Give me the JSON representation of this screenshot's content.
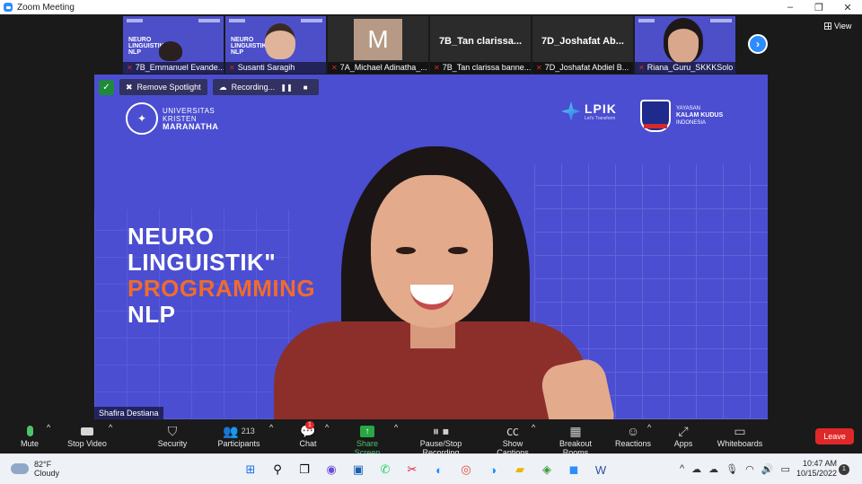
{
  "window": {
    "title": "Zoom Meeting",
    "minimize": "–",
    "maximize": "❐",
    "close": "✕"
  },
  "view_button": "View",
  "thumbnails": [
    {
      "name": "7B_Emmanuel Evande...",
      "type": "slide",
      "muted": true
    },
    {
      "name": "Susanti Saragih",
      "type": "slide",
      "muted": true
    },
    {
      "name": "7A_Michael Adinatha_...",
      "type": "avatar",
      "avatar_letter": "M",
      "muted": true
    },
    {
      "name": "7B_Tan clarissa banne...",
      "type": "name",
      "display": "7B_Tan clarissa...",
      "muted": true
    },
    {
      "name": "7D_Joshafat Abdiel B...",
      "type": "name",
      "display": "7D_Joshafat Ab...",
      "muted": true
    },
    {
      "name": "Riana_Guru_SKKKSolo",
      "type": "video",
      "muted": true
    }
  ],
  "slide_mini_title": [
    "NEURO",
    "LINGUISTIK\"",
    "PROGRAMMING",
    "NLP"
  ],
  "video_toolbar": {
    "remove_spotlight": "Remove Spotlight",
    "recording": "Recording..."
  },
  "slide": {
    "university": [
      "UNIVERSITAS",
      "KRISTEN",
      "MARANATHA"
    ],
    "lpik": "LPIK",
    "lpik_sub": "Let's Transform",
    "yayasan": [
      "YAYASAN",
      "KALAM KUDUS",
      "INDONESIA"
    ],
    "title_lines": [
      "NEURO",
      "LINGUISTIK\"",
      "PROGRAMMING",
      "NLP"
    ]
  },
  "speaker_name": "Shafira Destiana",
  "toolbar": {
    "mute": "Mute",
    "stop_video": "Stop Video",
    "security": "Security",
    "participants": "Participants",
    "participants_count": "213",
    "chat": "Chat",
    "chat_badge": "1",
    "share_screen": "Share Screen",
    "pause_stop_recording": "Pause/Stop Recording",
    "show_captions": "Show Captions",
    "breakout_rooms": "Breakout Rooms",
    "reactions": "Reactions",
    "apps": "Apps",
    "whiteboards": "Whiteboards",
    "leave": "Leave"
  },
  "taskbar": {
    "temperature": "82°F",
    "weather": "Cloudy",
    "time": "10:47 AM",
    "date": "10/15/2022",
    "notifications": "1"
  },
  "colors": {
    "slide_bg": "#4b4ed1",
    "accent_orange": "#f26b2b",
    "leave_red": "#e0282a",
    "zoom_blue": "#2d8cff"
  }
}
